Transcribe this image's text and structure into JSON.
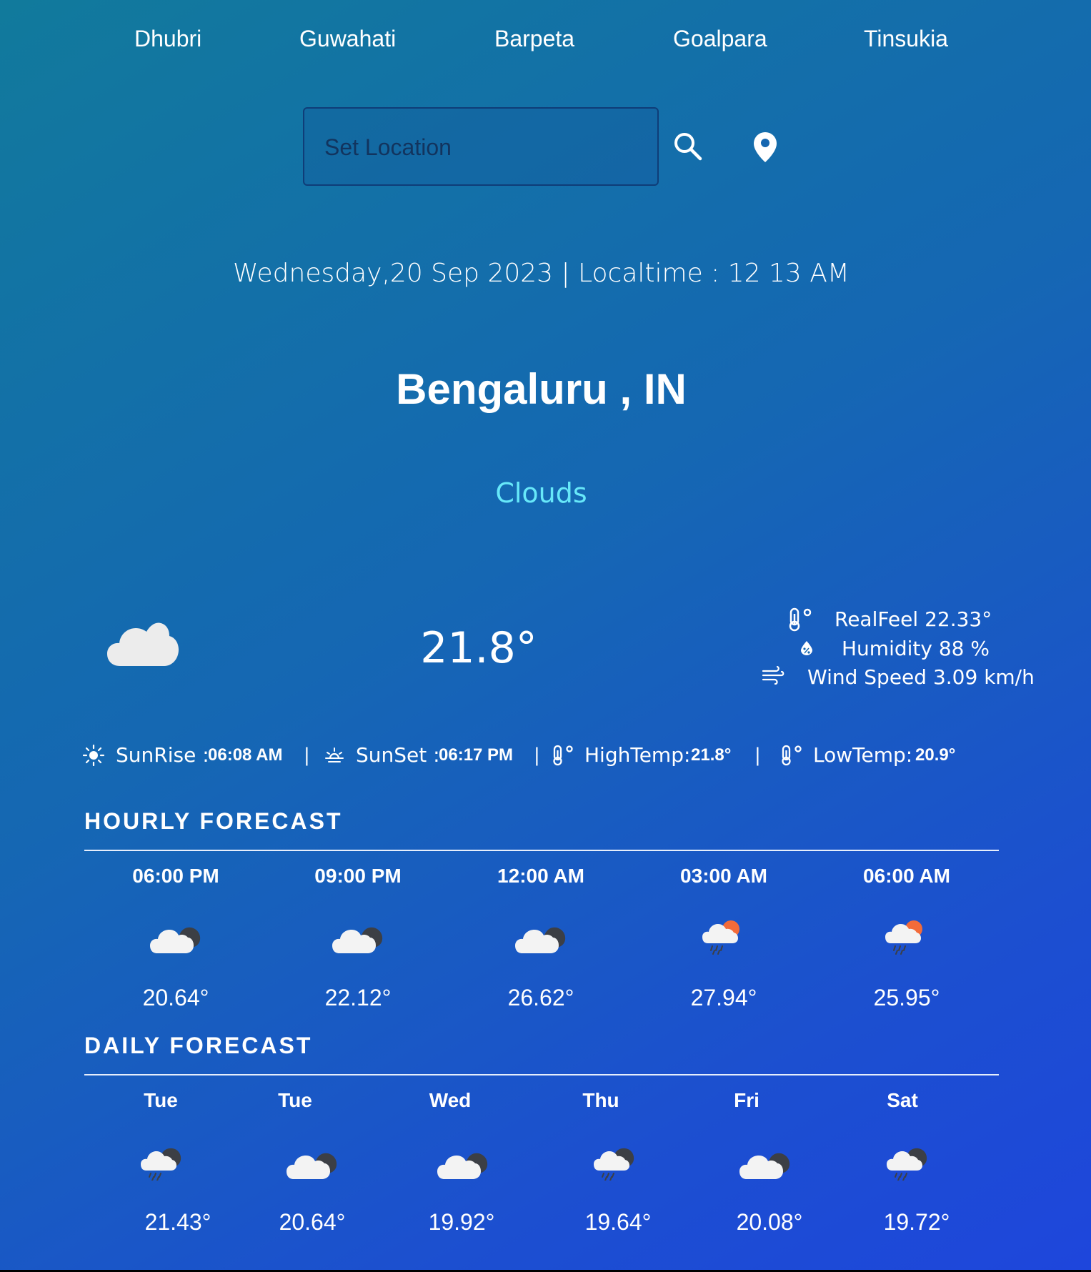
{
  "nav": {
    "cities": [
      "Dhubri",
      "Guwahati",
      "Barpeta",
      "Goalpara",
      "Tinsukia"
    ]
  },
  "search": {
    "placeholder": "Set Location",
    "search_icon": "search-icon",
    "location_icon": "location-pin-icon"
  },
  "header": {
    "datetime": "Wednesday,20 Sep 2023 | Localtime : 12 13 AM",
    "city": "Bengaluru , IN",
    "condition": "Clouds"
  },
  "current": {
    "icon": "cloud-icon",
    "temperature": "21.8°",
    "realfeel": "RealFeel 22.33°",
    "humidity": "Humidity 88 %",
    "wind": "Wind Speed 3.09 km/h"
  },
  "sun": {
    "sunrise_label": "SunRise :",
    "sunrise_value": "06:08 AM",
    "sunset_label": "SunSet :",
    "sunset_value": "06:17 PM",
    "high_label": "HighTemp:",
    "high_value": "21.8°",
    "low_label": "LowTemp:",
    "low_value": "20.9°",
    "separator": "|"
  },
  "hourly": {
    "title": "HOURLY FORECAST",
    "items": [
      {
        "time": "06:00 PM",
        "icon": "cloudy-night-icon",
        "temp": "20.64°"
      },
      {
        "time": "09:00 PM",
        "icon": "cloudy-night-icon",
        "temp": "22.12°"
      },
      {
        "time": "12:00 AM",
        "icon": "cloudy-night-icon",
        "temp": "26.62°"
      },
      {
        "time": "03:00 AM",
        "icon": "rain-sun-icon",
        "temp": "27.94°"
      },
      {
        "time": "06:00 AM",
        "icon": "rain-sun-icon",
        "temp": "25.95°"
      }
    ]
  },
  "daily": {
    "title": "DAILY FORECAST",
    "items": [
      {
        "day": "Tue",
        "icon": "rain-night-icon",
        "temp": "21.43°"
      },
      {
        "day": "Tue",
        "icon": "cloudy-night-icon",
        "temp": "20.64°"
      },
      {
        "day": "Wed",
        "icon": "cloudy-night-icon",
        "temp": "19.92°"
      },
      {
        "day": "Thu",
        "icon": "rain-night-icon",
        "temp": "19.64°"
      },
      {
        "day": "Fri",
        "icon": "cloudy-night-icon",
        "temp": "20.08°"
      },
      {
        "day": "Sat",
        "icon": "rain-night-icon",
        "temp": "19.72°"
      }
    ]
  },
  "colors": {
    "condition": "#67e8f9",
    "sun_orange": "#f26b3a"
  }
}
